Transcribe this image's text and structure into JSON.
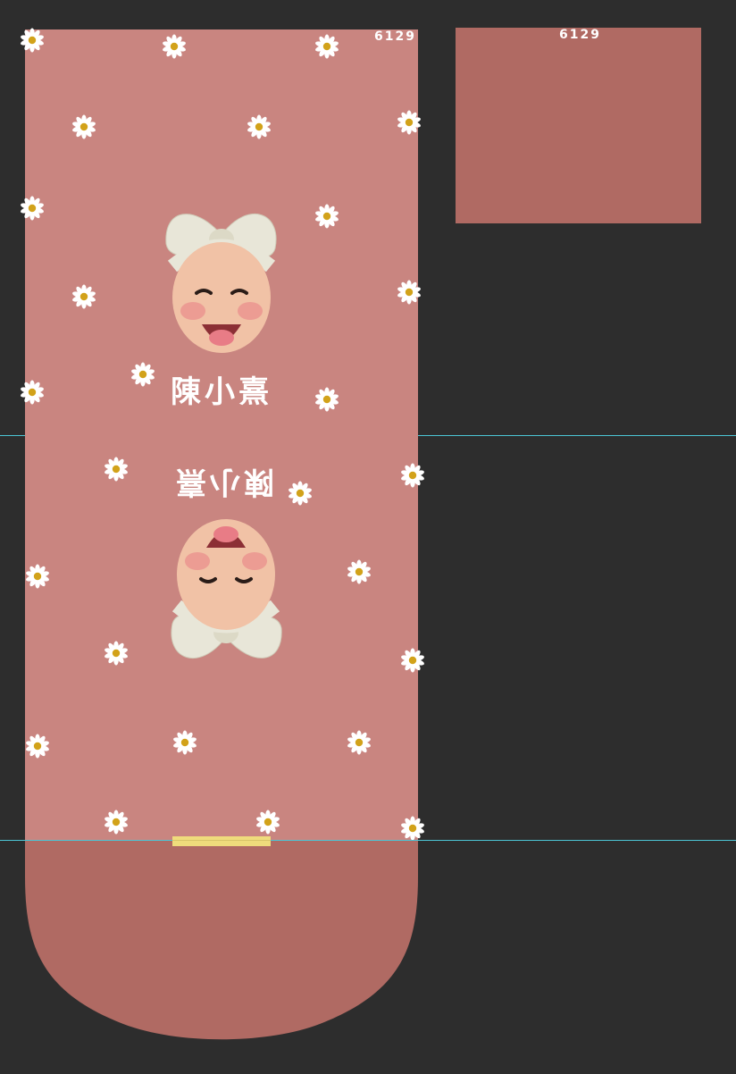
{
  "canvas": {
    "background": "#2d2d2d"
  },
  "artwork": {
    "main_color": "#c98580",
    "accent_color": "#b06a63",
    "guide_color": "#4cc6d6",
    "tab_color": "#efdc7c",
    "code_label": "6129",
    "side_code_label": "6129",
    "name_top": "陳小熹",
    "name_bottom": "陳小熹",
    "icons": {
      "daisy": "daisy-icon",
      "baby_face": "baby-face-icon",
      "bow": "bow-icon"
    }
  }
}
